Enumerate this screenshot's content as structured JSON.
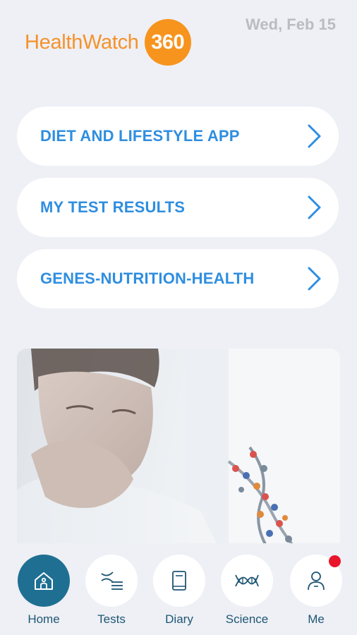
{
  "header": {
    "logo_text": "HealthWatch",
    "logo_badge": "360",
    "date": "Wed, Feb 15"
  },
  "menu": [
    {
      "label": "DIET AND LIFESTYLE APP",
      "icon": "chevron-right-icon"
    },
    {
      "label": "MY TEST RESULTS",
      "icon": "chevron-right-icon"
    },
    {
      "label": "GENES-NUTRITION-HEALTH",
      "icon": "chevron-right-icon"
    }
  ],
  "tabs": [
    {
      "label": "Home",
      "icon": "home-icon",
      "active": true
    },
    {
      "label": "Tests",
      "icon": "dna-list-icon"
    },
    {
      "label": "Diary",
      "icon": "book-icon"
    },
    {
      "label": "Science",
      "icon": "dna-icon"
    },
    {
      "label": "Me",
      "icon": "person-icon",
      "notification": true
    }
  ],
  "colors": {
    "accent_blue": "#2f8ee0",
    "brand_orange": "#f7941d",
    "tab_active": "#1f6f93",
    "notification_red": "#e8152b"
  }
}
